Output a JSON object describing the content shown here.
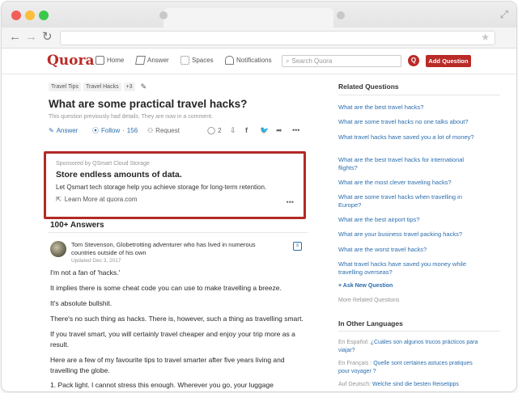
{
  "browser": {
    "icons": {
      "back": "back-arrow-icon",
      "forward": "forward-arrow-icon",
      "reload": "reload-icon",
      "bookmark": "star-icon",
      "resize": "fullscreen-icon"
    },
    "url": ""
  },
  "header": {
    "logo": "Quora",
    "nav": [
      {
        "label": "Home",
        "icon": "home-icon"
      },
      {
        "label": "Answer",
        "icon": "answer-icon"
      },
      {
        "label": "Spaces",
        "icon": "spaces-icon"
      },
      {
        "label": "Notifications",
        "icon": "bell-icon"
      }
    ],
    "search_placeholder": "Search Quora",
    "avatar_letter": "Q",
    "add_question": "Add Question",
    "accent": "#b92b27"
  },
  "question": {
    "tags": [
      "Travel Tips",
      "Travel Hacks",
      "+3"
    ],
    "title": "What are some practical travel hacks?",
    "note": "This question previously had details. They are now in a comment.",
    "actions": {
      "answer": "Answer",
      "follow": "Follow",
      "follow_count": "156",
      "request": "Request",
      "comments": "2"
    }
  },
  "ad": {
    "sponsor": "Sponsored by QSmart Cloud Storage",
    "title": "Store endless amounts of data.",
    "desc": "Let Qsmart tech storage help you achieve storage for long-term retention.",
    "link": "Learn More at quora.com",
    "highlight": "#b22a25"
  },
  "answers": {
    "count_label": "100+ Answers",
    "author": "Tom Stevenson, Globetrotting adventurer who has lived in numerous countries outside of his own",
    "date": "Updated Dec 3, 2017",
    "paragraphs": [
      "I'm not a fan of 'hacks.'",
      "It implies there is some cheat code you can use to make travelling a breeze.",
      "It's absolute bullshit.",
      "There's no such thing as hacks. There is, however, such a thing as travelling smart.",
      "If you travel smart, you will certainly travel cheaper and enjoy your trip more as a result.",
      "Here are a few of my favourite tips to travel smarter after five years living and travelling the globe.",
      "1. Pack light. I cannot stress this enough. Wherever you go, your luggage"
    ]
  },
  "sidebar": {
    "related_heading": "Related Questions",
    "related": [
      "What are the best travel hacks?",
      "What are some travel hacks no one talks about?",
      "What travel hacks have saved you a lot of money?",
      "What are the best travel hacks for international flights?",
      "What are the most clever traveling hacks?",
      "What are some travel hacks when travelling in Europe?",
      "What are the best airport tips?",
      "What are your business travel packing hacks?",
      "What are the worst travel hacks?",
      "What travel hacks have saved you money while travelling overseas?"
    ],
    "ask_new": "Ask New Question",
    "more_related": "More Related Questions",
    "languages_heading": "In Other Languages",
    "languages": [
      {
        "label": "En Español:",
        "text": "¿Cuáles son algunos trucos prácticos para viajar?"
      },
      {
        "label": "En Français :",
        "text": "Quelle sont certaines astuces pratiques pour voyager ?"
      },
      {
        "label": "Auf Deutsch:",
        "text": "Welche sind die besten Reisetipps"
      }
    ]
  }
}
